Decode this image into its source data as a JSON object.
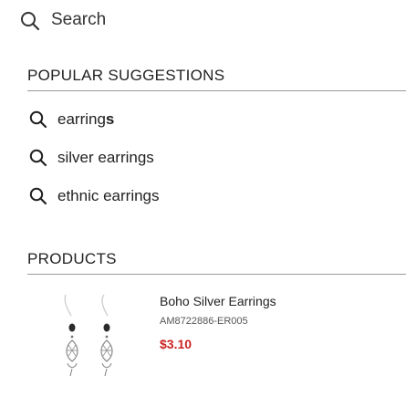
{
  "search": {
    "placeholder": "Search"
  },
  "popular": {
    "title": "POPULAR SUGGESTIONS",
    "items": [
      {
        "prefix": "earring",
        "suffix": "s"
      },
      {
        "prefix": "silver earrings",
        "suffix": ""
      },
      {
        "prefix": "ethnic earrings",
        "suffix": ""
      }
    ]
  },
  "products": {
    "title": "PRODUCTS",
    "items": [
      {
        "name": "Boho Silver Earrings",
        "sku": "AM8722886-ER005",
        "price": "$3.10"
      }
    ]
  },
  "colors": {
    "price": "#cc2222",
    "rule": "#999999",
    "text": "#222222"
  },
  "icons": {
    "search": "search-icon",
    "suggestion": "search-icon"
  }
}
